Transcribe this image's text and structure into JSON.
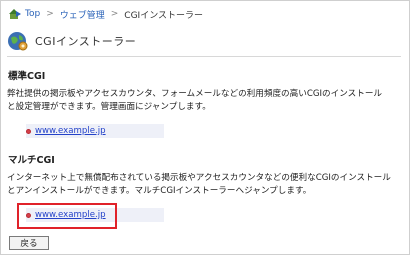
{
  "breadcrumb": {
    "items": [
      {
        "label": "Top"
      },
      {
        "label": "ウェブ管理"
      },
      {
        "label": "CGIインストーラー"
      }
    ],
    "separator": ">"
  },
  "header": {
    "title": "CGIインストーラー"
  },
  "sections": [
    {
      "title": "標準CGI",
      "description_line1": "弊社提供の掲示板やアクセスカウンタ、フォームメールなどの利用頻度の高いCGIのインストール",
      "description_line2": "と設定管理ができます。管理画面にジャンプします。",
      "link": "www.example.jp"
    },
    {
      "title": "マルチCGI",
      "description_line1": "インターネット上で無償配布されている掲示板やアクセスカウンタなどの便利なCGIのインストール",
      "description_line2": "とアンインストールができます。マルチCGIインストーラーへジャンプします。",
      "link": "www.example.jp"
    }
  ],
  "back_button": {
    "label": "戻る"
  },
  "colors": {
    "link": "#2442c9",
    "breadcrumb_link": "#2b63b8",
    "highlight": "#e0222a",
    "bullet": "#d6404a"
  },
  "icons": {
    "home": "home-arrow-icon",
    "header": "globe-gear-icon",
    "bullet": "red-bullet-icon"
  }
}
